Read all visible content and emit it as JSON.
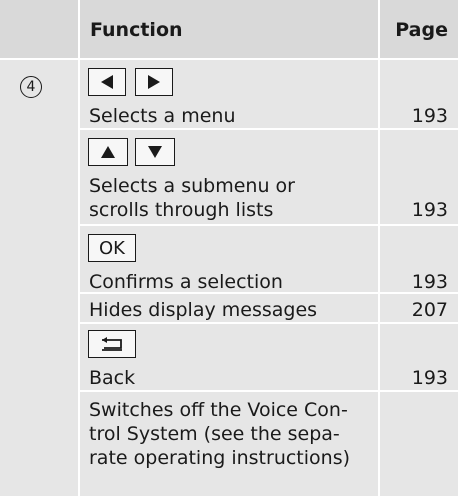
{
  "header": {
    "function_label": "Function",
    "page_label": "Page"
  },
  "row": {
    "number": "4",
    "keys": {
      "left_arrow": "left-triangle-icon",
      "right_arrow": "right-triangle-icon",
      "up_arrow": "up-triangle-icon",
      "down_arrow": "down-triangle-icon",
      "ok_label": "OK",
      "back_icon": "back-icon"
    },
    "entries": [
      {
        "text": "Selects a menu",
        "page": "193"
      },
      {
        "text_lines": [
          "Selects a submenu or",
          "scrolls through lists"
        ],
        "page": "193"
      },
      {
        "text": "Confirms a selection",
        "page": "193"
      },
      {
        "text": "Hides display messages",
        "page": "207"
      },
      {
        "text": "Back",
        "page": "193"
      },
      {
        "text_lines": [
          "Switches off the Voice Con-",
          "trol System (see the sepa-",
          "rate operating instructions)"
        ],
        "page": ""
      }
    ]
  }
}
